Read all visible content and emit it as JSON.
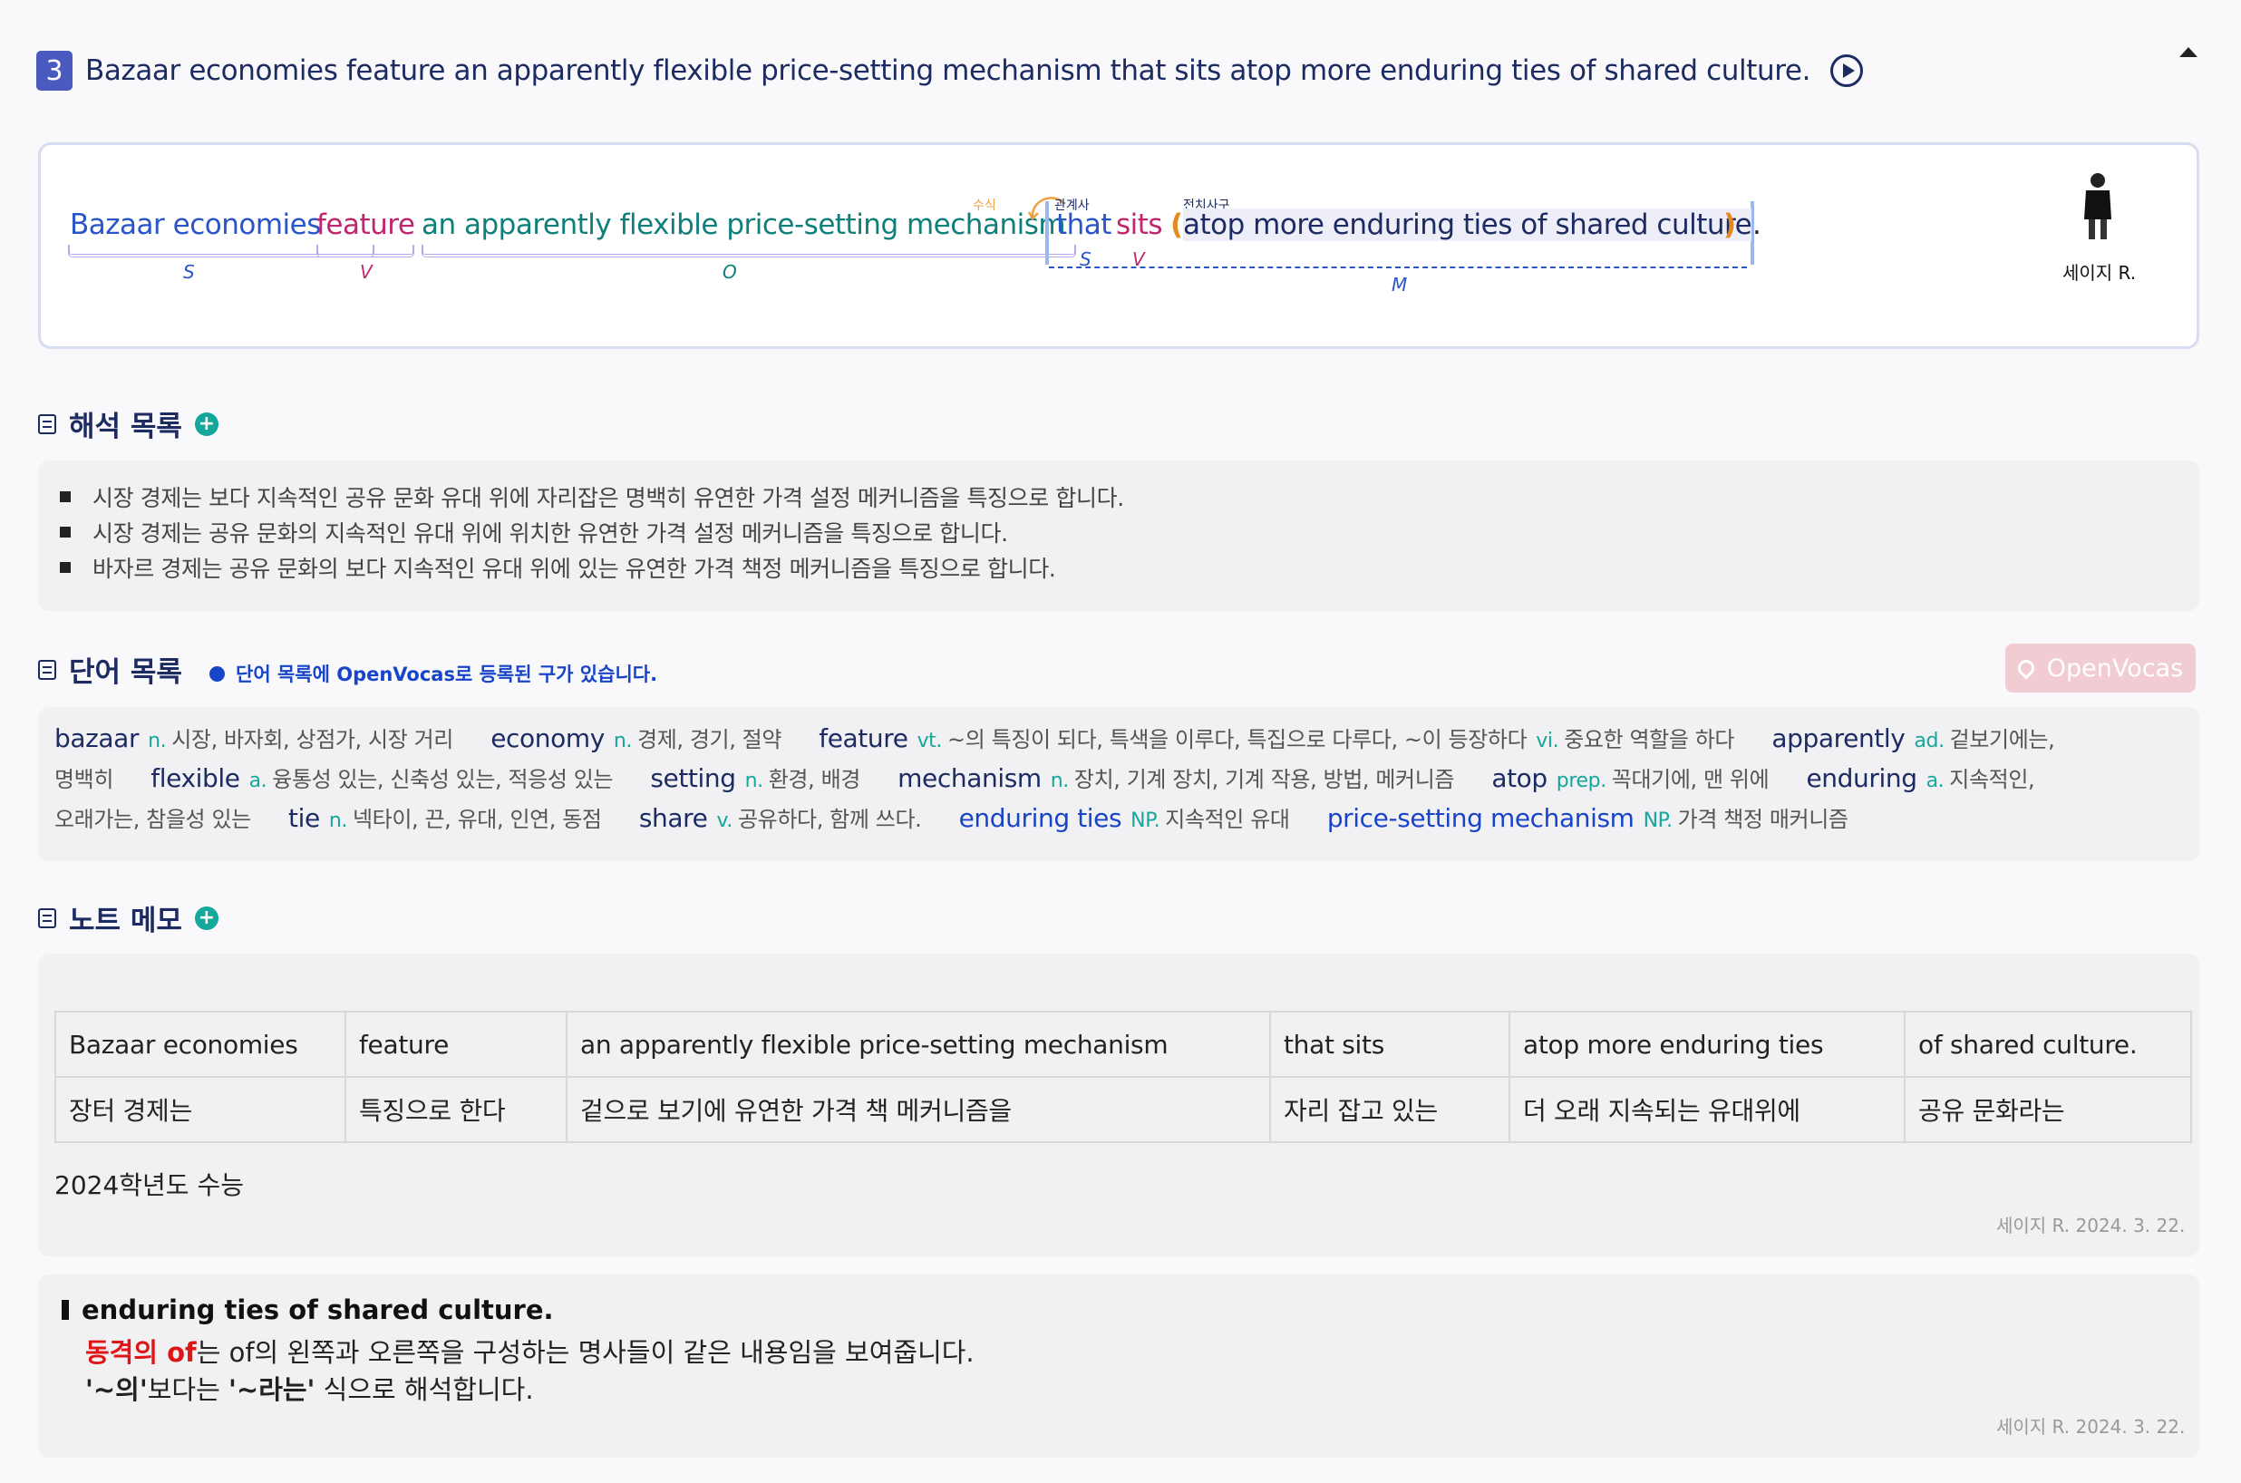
{
  "header": {
    "number": "3",
    "sentence": "Bazaar economies feature an apparently flexible price-setting mechanism that sits atop more enduring ties of shared culture."
  },
  "analysis": {
    "tokens": {
      "subject": "Bazaar economies",
      "verb": "feature",
      "object": "an apparently flexible price-setting mechanism",
      "rel_subject": "that",
      "rel_verb": "sits",
      "open_paren": "(",
      "prep_phrase": "atop more enduring ties of shared culture",
      "close_paren": ")",
      "period": "."
    },
    "roles": {
      "s": "S",
      "v": "V",
      "o": "O",
      "s2": "S",
      "v2": "V",
      "m": "M"
    },
    "tags": {
      "modify": "수식",
      "relative": "관계사",
      "prep_phrase": "전치사구"
    },
    "author": "세이지 R."
  },
  "interpretation": {
    "title": "해석 목록",
    "items": [
      "시장 경제는 보다 지속적인 공유 문화 유대 위에 자리잡은 명백히 유연한 가격 설정 메커니즘을 특징으로 합니다.",
      "시장 경제는 공유 문화의 지속적인 유대 위에 위치한 유연한 가격 설정 메커니즘을 특징으로 합니다.",
      "바자르 경제는 공유 문화의 보다 지속적인 유대 위에 있는 유연한 가격 책정 메커니즘을 특징으로 합니다."
    ]
  },
  "words": {
    "title": "단어 목록",
    "note": "단어 목록에 OpenVocas로 등록된 구가 있습니다.",
    "openvocas_label": "OpenVocas",
    "line1": [
      {
        "w": "bazaar",
        "p": "n.",
        "d": "시장, 바자회, 상점가, 시장 거리"
      },
      {
        "w": "economy",
        "p": "n.",
        "d": "경제, 경기, 절약"
      },
      {
        "w": "feature",
        "p": "vt.",
        "d": "~의 특징이 되다, 특색을 이루다, 특집으로 다루다, ~이 등장하다",
        "p2": "vi.",
        "d2": "중요한 역할을 하다"
      },
      {
        "w": "apparently",
        "p": "ad.",
        "d": "겉보기에는,"
      }
    ],
    "line2_start": "명백히",
    "line2": [
      {
        "w": "flexible",
        "p": "a.",
        "d": "융통성 있는, 신축성 있는, 적응성 있는"
      },
      {
        "w": "setting",
        "p": "n.",
        "d": "환경, 배경"
      },
      {
        "w": "mechanism",
        "p": "n.",
        "d": "장치, 기계 장치, 기계 작용, 방법, 메커니즘"
      },
      {
        "w": "atop",
        "p": "prep.",
        "d": "꼭대기에, 맨 위에"
      },
      {
        "w": "enduring",
        "p": "a.",
        "d": "지속적인,"
      }
    ],
    "line3_start": "오래가는, 참을성 있는",
    "line3": [
      {
        "w": "tie",
        "p": "n.",
        "d": "넥타이, 끈, 유대, 인연, 동점"
      },
      {
        "w": "share",
        "p": "v.",
        "d": "공유하다, 함께 쓰다."
      },
      {
        "w": "enduring ties",
        "p": "NP.",
        "d": "지속적인 유대"
      },
      {
        "w": "price-setting mechanism",
        "p": "NP.",
        "d": "가격 책정 매커니즘"
      }
    ]
  },
  "memo": {
    "title": "노트 메모",
    "table": [
      [
        "Bazaar economies",
        "feature",
        "an apparently flexible price-setting mechanism",
        "that sits",
        "atop more enduring ties",
        "of shared culture."
      ],
      [
        "장터 경제는",
        "특징으로 한다",
        "겉으로 보기에 유연한 가격 책 메커니즘을",
        " 자리 잡고 있는",
        "더 오래 지속되는  유대위에",
        "공유 문화라는"
      ]
    ],
    "source": "2024학년도 수능",
    "signature_author": "세이지 R.",
    "signature_date": "2024. 3. 22."
  },
  "grammar_note": {
    "heading": "enduring ties of shared culture.",
    "line2_red": "동격의 of",
    "line2_rest": "는 of의 왼쪽과 오른쪽을 구성하는 명사들이 같은 내용임을 보여줍니다.",
    "line3_q1": "'~의'",
    "line3_mid": "보다는 ",
    "line3_q2": "'~라는'",
    "line3_rest": " 식으로 해석합니다.",
    "signature_author": "세이지 R.",
    "signature_date": "2024. 3. 22."
  },
  "colors": {
    "subject": "#2a55c9",
    "verb": "#c0266e",
    "object": "#0e7f79",
    "modify_tag": "#f0a040",
    "paren": "#e58a1f",
    "badge": "#4a5abf",
    "plus": "#14a79b"
  },
  "icons": [
    "play-icon",
    "collapse-caret-icon",
    "list-icon",
    "box-icon",
    "note-icon",
    "plus-icon",
    "icecream-icon"
  ]
}
